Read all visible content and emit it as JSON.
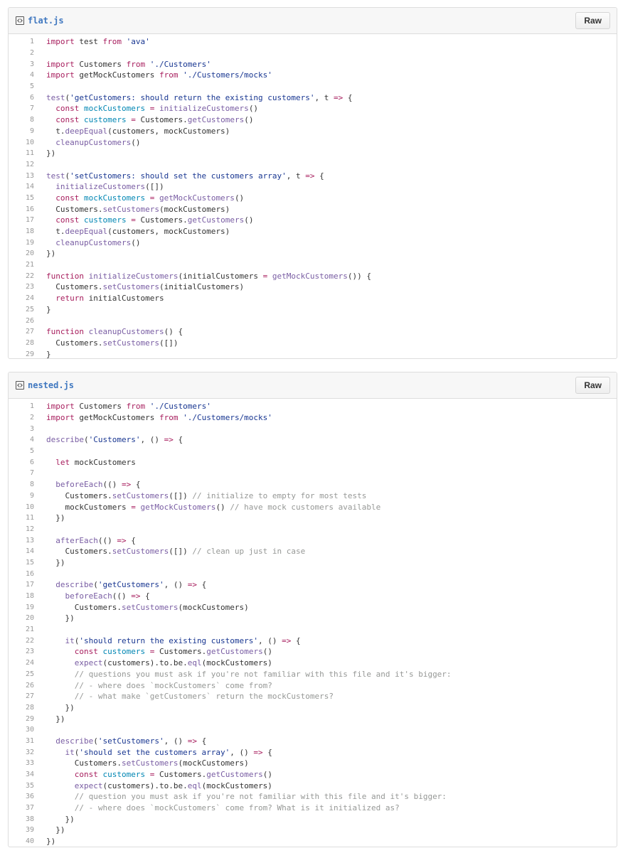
{
  "files": [
    {
      "name": "flat.js",
      "raw_label": "Raw",
      "lines": [
        [
          [
            "import",
            "k"
          ],
          [
            " test ",
            "p"
          ],
          [
            "from",
            "k"
          ],
          [
            " ",
            "p"
          ],
          [
            "'ava'",
            "s"
          ]
        ],
        [],
        [
          [
            "import",
            "k"
          ],
          [
            " Customers ",
            "p"
          ],
          [
            "from",
            "k"
          ],
          [
            " ",
            "p"
          ],
          [
            "'./Customers'",
            "s"
          ]
        ],
        [
          [
            "import",
            "k"
          ],
          [
            " getMockCustomers ",
            "p"
          ],
          [
            "from",
            "k"
          ],
          [
            " ",
            "p"
          ],
          [
            "'./Customers/mocks'",
            "s"
          ]
        ],
        [],
        [
          [
            "test",
            "f"
          ],
          [
            "(",
            "p"
          ],
          [
            "'getCustomers: should return the existing customers'",
            "s"
          ],
          [
            ", t ",
            "p"
          ],
          [
            "=>",
            "k"
          ],
          [
            " {",
            "p"
          ]
        ],
        [
          [
            "  ",
            "p"
          ],
          [
            "const",
            "k"
          ],
          [
            " ",
            "p"
          ],
          [
            "mockCustomers",
            "v"
          ],
          [
            " ",
            "p"
          ],
          [
            "=",
            "k"
          ],
          [
            " ",
            "p"
          ],
          [
            "initializeCustomers",
            "f"
          ],
          [
            "()",
            "p"
          ]
        ],
        [
          [
            "  ",
            "p"
          ],
          [
            "const",
            "k"
          ],
          [
            " ",
            "p"
          ],
          [
            "customers",
            "v"
          ],
          [
            " ",
            "p"
          ],
          [
            "=",
            "k"
          ],
          [
            " Customers.",
            "p"
          ],
          [
            "getCustomers",
            "f"
          ],
          [
            "()",
            "p"
          ]
        ],
        [
          [
            "  t.",
            "p"
          ],
          [
            "deepEqual",
            "f"
          ],
          [
            "(customers, mockCustomers)",
            "p"
          ]
        ],
        [
          [
            "  ",
            "p"
          ],
          [
            "cleanupCustomers",
            "f"
          ],
          [
            "()",
            "p"
          ]
        ],
        [
          [
            "})",
            "p"
          ]
        ],
        [],
        [
          [
            "test",
            "f"
          ],
          [
            "(",
            "p"
          ],
          [
            "'setCustomers: should set the customers array'",
            "s"
          ],
          [
            ", t ",
            "p"
          ],
          [
            "=>",
            "k"
          ],
          [
            " {",
            "p"
          ]
        ],
        [
          [
            "  ",
            "p"
          ],
          [
            "initializeCustomers",
            "f"
          ],
          [
            "([])",
            "p"
          ]
        ],
        [
          [
            "  ",
            "p"
          ],
          [
            "const",
            "k"
          ],
          [
            " ",
            "p"
          ],
          [
            "mockCustomers",
            "v"
          ],
          [
            " ",
            "p"
          ],
          [
            "=",
            "k"
          ],
          [
            " ",
            "p"
          ],
          [
            "getMockCustomers",
            "f"
          ],
          [
            "()",
            "p"
          ]
        ],
        [
          [
            "  Customers.",
            "p"
          ],
          [
            "setCustomers",
            "f"
          ],
          [
            "(mockCustomers)",
            "p"
          ]
        ],
        [
          [
            "  ",
            "p"
          ],
          [
            "const",
            "k"
          ],
          [
            " ",
            "p"
          ],
          [
            "customers",
            "v"
          ],
          [
            " ",
            "p"
          ],
          [
            "=",
            "k"
          ],
          [
            " Customers.",
            "p"
          ],
          [
            "getCustomers",
            "f"
          ],
          [
            "()",
            "p"
          ]
        ],
        [
          [
            "  t.",
            "p"
          ],
          [
            "deepEqual",
            "f"
          ],
          [
            "(customers, mockCustomers)",
            "p"
          ]
        ],
        [
          [
            "  ",
            "p"
          ],
          [
            "cleanupCustomers",
            "f"
          ],
          [
            "()",
            "p"
          ]
        ],
        [
          [
            "})",
            "p"
          ]
        ],
        [],
        [
          [
            "function",
            "k"
          ],
          [
            " ",
            "p"
          ],
          [
            "initializeCustomers",
            "f"
          ],
          [
            "(initialCustomers ",
            "p"
          ],
          [
            "=",
            "k"
          ],
          [
            " ",
            "p"
          ],
          [
            "getMockCustomers",
            "f"
          ],
          [
            "()) {",
            "p"
          ]
        ],
        [
          [
            "  Customers.",
            "p"
          ],
          [
            "setCustomers",
            "f"
          ],
          [
            "(initialCustomers)",
            "p"
          ]
        ],
        [
          [
            "  ",
            "p"
          ],
          [
            "return",
            "k"
          ],
          [
            " initialCustomers",
            "p"
          ]
        ],
        [
          [
            "}",
            "p"
          ]
        ],
        [],
        [
          [
            "function",
            "k"
          ],
          [
            " ",
            "p"
          ],
          [
            "cleanupCustomers",
            "f"
          ],
          [
            "() {",
            "p"
          ]
        ],
        [
          [
            "  Customers.",
            "p"
          ],
          [
            "setCustomers",
            "f"
          ],
          [
            "([])",
            "p"
          ]
        ],
        [
          [
            "}",
            "p"
          ]
        ]
      ]
    },
    {
      "name": "nested.js",
      "raw_label": "Raw",
      "lines": [
        [
          [
            "import",
            "k"
          ],
          [
            " Customers ",
            "p"
          ],
          [
            "from",
            "k"
          ],
          [
            " ",
            "p"
          ],
          [
            "'./Customers'",
            "s"
          ]
        ],
        [
          [
            "import",
            "k"
          ],
          [
            " getMockCustomers ",
            "p"
          ],
          [
            "from",
            "k"
          ],
          [
            " ",
            "p"
          ],
          [
            "'./Customers/mocks'",
            "s"
          ]
        ],
        [],
        [
          [
            "describe",
            "f"
          ],
          [
            "(",
            "p"
          ],
          [
            "'Customers'",
            "s"
          ],
          [
            ", () ",
            "p"
          ],
          [
            "=>",
            "k"
          ],
          [
            " {",
            "p"
          ]
        ],
        [],
        [
          [
            "  ",
            "p"
          ],
          [
            "let",
            "k"
          ],
          [
            " mockCustomers",
            "p"
          ]
        ],
        [],
        [
          [
            "  ",
            "p"
          ],
          [
            "beforeEach",
            "f"
          ],
          [
            "(() ",
            "p"
          ],
          [
            "=>",
            "k"
          ],
          [
            " {",
            "p"
          ]
        ],
        [
          [
            "    Customers.",
            "p"
          ],
          [
            "setCustomers",
            "f"
          ],
          [
            "([]) ",
            "p"
          ],
          [
            "// initialize to empty for most tests",
            "c"
          ]
        ],
        [
          [
            "    mockCustomers ",
            "p"
          ],
          [
            "=",
            "k"
          ],
          [
            " ",
            "p"
          ],
          [
            "getMockCustomers",
            "f"
          ],
          [
            "() ",
            "p"
          ],
          [
            "// have mock customers available",
            "c"
          ]
        ],
        [
          [
            "  })",
            "p"
          ]
        ],
        [],
        [
          [
            "  ",
            "p"
          ],
          [
            "afterEach",
            "f"
          ],
          [
            "(() ",
            "p"
          ],
          [
            "=>",
            "k"
          ],
          [
            " {",
            "p"
          ]
        ],
        [
          [
            "    Customers.",
            "p"
          ],
          [
            "setCustomers",
            "f"
          ],
          [
            "([]) ",
            "p"
          ],
          [
            "// clean up just in case",
            "c"
          ]
        ],
        [
          [
            "  })",
            "p"
          ]
        ],
        [],
        [
          [
            "  ",
            "p"
          ],
          [
            "describe",
            "f"
          ],
          [
            "(",
            "p"
          ],
          [
            "'getCustomers'",
            "s"
          ],
          [
            ", () ",
            "p"
          ],
          [
            "=>",
            "k"
          ],
          [
            " {",
            "p"
          ]
        ],
        [
          [
            "    ",
            "p"
          ],
          [
            "beforeEach",
            "f"
          ],
          [
            "(() ",
            "p"
          ],
          [
            "=>",
            "k"
          ],
          [
            " {",
            "p"
          ]
        ],
        [
          [
            "      Customers.",
            "p"
          ],
          [
            "setCustomers",
            "f"
          ],
          [
            "(mockCustomers)",
            "p"
          ]
        ],
        [
          [
            "    })",
            "p"
          ]
        ],
        [],
        [
          [
            "    ",
            "p"
          ],
          [
            "it",
            "f"
          ],
          [
            "(",
            "p"
          ],
          [
            "'should return the existing customers'",
            "s"
          ],
          [
            ", () ",
            "p"
          ],
          [
            "=>",
            "k"
          ],
          [
            " {",
            "p"
          ]
        ],
        [
          [
            "      ",
            "p"
          ],
          [
            "const",
            "k"
          ],
          [
            " ",
            "p"
          ],
          [
            "customers",
            "v"
          ],
          [
            " ",
            "p"
          ],
          [
            "=",
            "k"
          ],
          [
            " Customers.",
            "p"
          ],
          [
            "getCustomers",
            "f"
          ],
          [
            "()",
            "p"
          ]
        ],
        [
          [
            "      ",
            "p"
          ],
          [
            "expect",
            "f"
          ],
          [
            "(customers).to.be.",
            "p"
          ],
          [
            "eql",
            "f"
          ],
          [
            "(mockCustomers)",
            "p"
          ]
        ],
        [
          [
            "      ",
            "p"
          ],
          [
            "// questions you must ask if you're not familiar with this file and it's bigger:",
            "c"
          ]
        ],
        [
          [
            "      ",
            "p"
          ],
          [
            "// - where does `mockCustomers` come from?",
            "c"
          ]
        ],
        [
          [
            "      ",
            "p"
          ],
          [
            "// - what make `getCustomers` return the mockCustomers?",
            "c"
          ]
        ],
        [
          [
            "    })",
            "p"
          ]
        ],
        [
          [
            "  })",
            "p"
          ]
        ],
        [],
        [
          [
            "  ",
            "p"
          ],
          [
            "describe",
            "f"
          ],
          [
            "(",
            "p"
          ],
          [
            "'setCustomers'",
            "s"
          ],
          [
            ", () ",
            "p"
          ],
          [
            "=>",
            "k"
          ],
          [
            " {",
            "p"
          ]
        ],
        [
          [
            "    ",
            "p"
          ],
          [
            "it",
            "f"
          ],
          [
            "(",
            "p"
          ],
          [
            "'should set the customers array'",
            "s"
          ],
          [
            ", () ",
            "p"
          ],
          [
            "=>",
            "k"
          ],
          [
            " {",
            "p"
          ]
        ],
        [
          [
            "      Customers.",
            "p"
          ],
          [
            "setCustomers",
            "f"
          ],
          [
            "(mockCustomers)",
            "p"
          ]
        ],
        [
          [
            "      ",
            "p"
          ],
          [
            "const",
            "k"
          ],
          [
            " ",
            "p"
          ],
          [
            "customers",
            "v"
          ],
          [
            " ",
            "p"
          ],
          [
            "=",
            "k"
          ],
          [
            " Customers.",
            "p"
          ],
          [
            "getCustomers",
            "f"
          ],
          [
            "()",
            "p"
          ]
        ],
        [
          [
            "      ",
            "p"
          ],
          [
            "expect",
            "f"
          ],
          [
            "(customers).to.be.",
            "p"
          ],
          [
            "eql",
            "f"
          ],
          [
            "(mockCustomers)",
            "p"
          ]
        ],
        [
          [
            "      ",
            "p"
          ],
          [
            "// question you must ask if you're not familiar with this file and it's bigger:",
            "c"
          ]
        ],
        [
          [
            "      ",
            "p"
          ],
          [
            "// - where does `mockCustomers` come from? What is it initialized as?",
            "c"
          ]
        ],
        [
          [
            "    })",
            "p"
          ]
        ],
        [
          [
            "  })",
            "p"
          ]
        ],
        [
          [
            "})",
            "p"
          ]
        ]
      ]
    }
  ]
}
